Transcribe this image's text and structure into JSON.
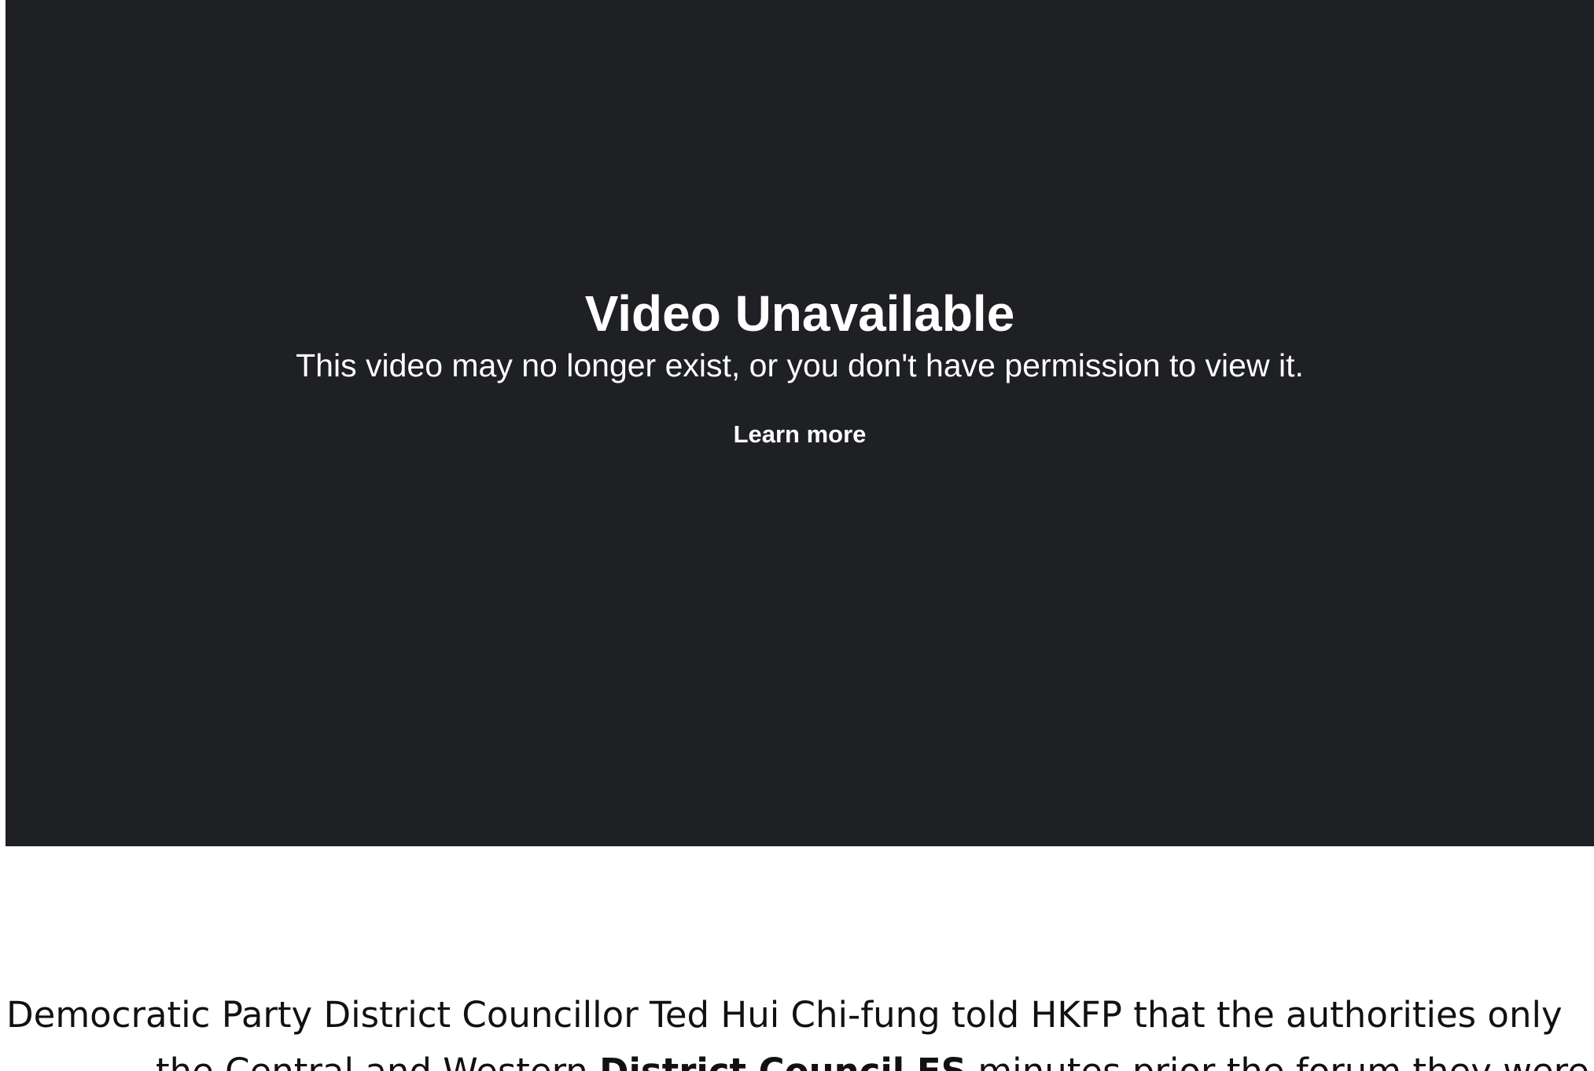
{
  "video": {
    "title": "Video Unavailable",
    "message": "This video may no longer exist, or you don't have permission to view it.",
    "learn_more_label": "Learn more"
  },
  "article": {
    "paragraph_line1": "Democratic Party District Councillor Ted Hui Chi-fung told HKFP that the authorities only",
    "paragraph_line2_start": "the Central and Western ",
    "paragraph_line2_link": "District Council ES",
    "paragraph_line2_end": " minutes prior the forum they were about to"
  },
  "colors": {
    "video_background": "#1f2023",
    "page_background": "#ffffff",
    "text_dark": "#111111"
  }
}
